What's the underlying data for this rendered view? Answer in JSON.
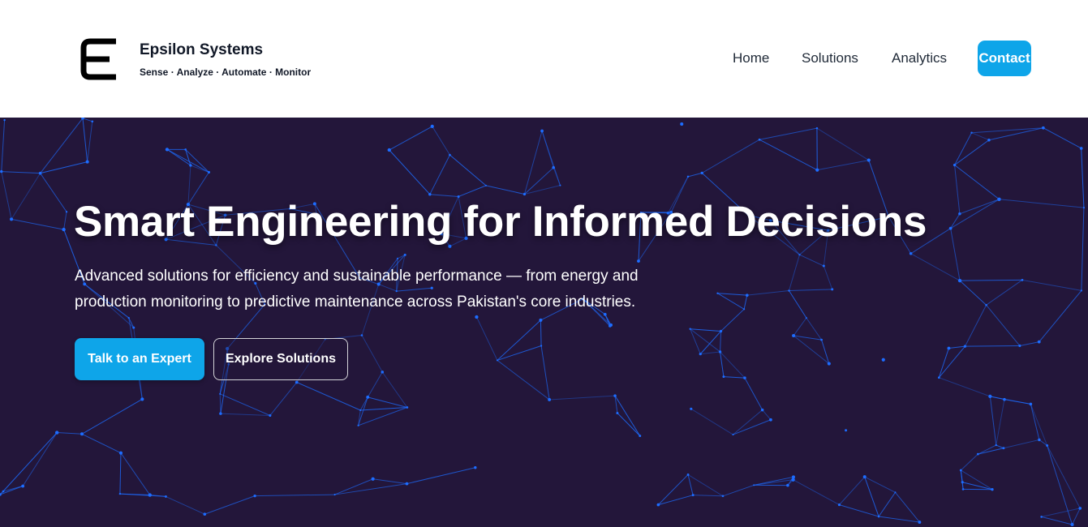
{
  "header": {
    "brand_name": "Epsilon Systems",
    "tagline": "Sense · Analyze · Automate · Monitor",
    "logo_icon": "epsilon-logo-icon",
    "nav": {
      "home": "Home",
      "solutions": "Solutions",
      "analytics": "Analytics",
      "contact": "Contact"
    }
  },
  "hero": {
    "title": "Smart Engineering for Informed Decisions",
    "subtitle": "Advanced solutions for efficiency and sustainable performance — from energy and production monitoring to predictive maintenance across Pakistan's core industries.",
    "primary_cta": "Talk to an Expert",
    "secondary_cta": "Explore Solutions"
  },
  "colors": {
    "accent": "#0ea5e9",
    "hero_background": "#23163a",
    "network_lines": "#1d6cff"
  }
}
